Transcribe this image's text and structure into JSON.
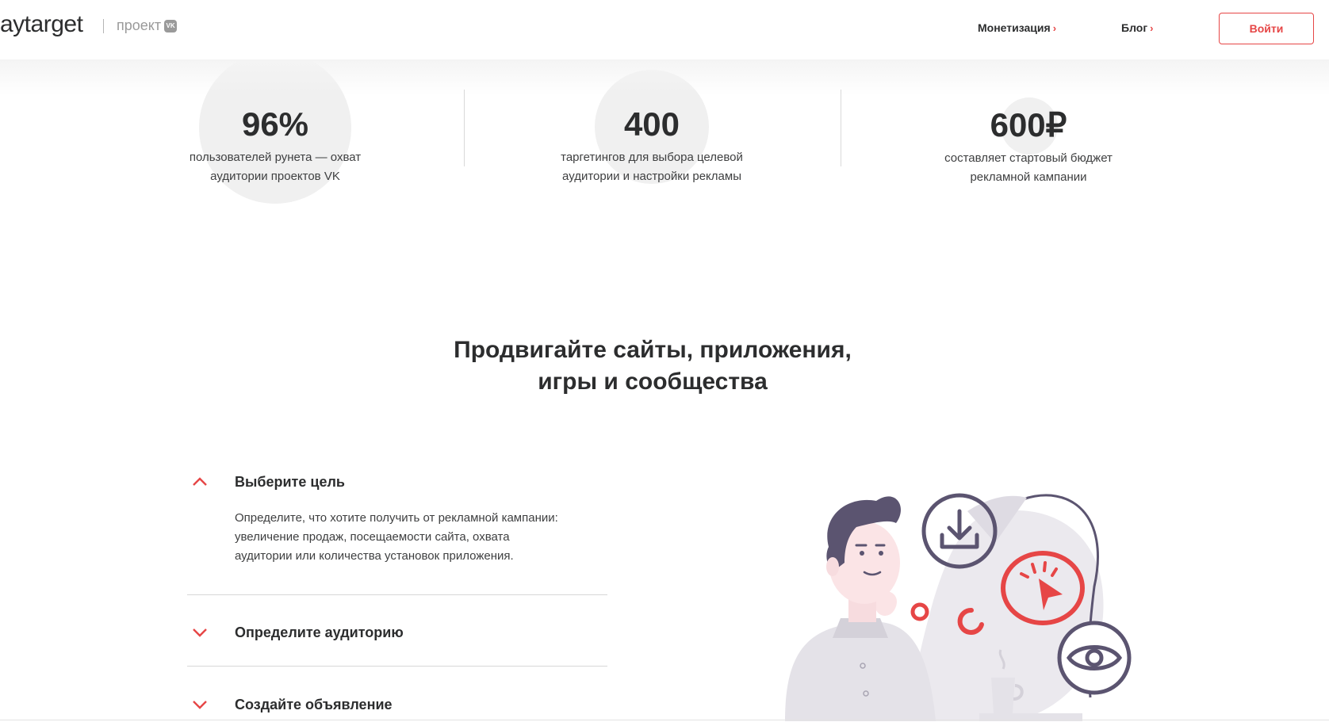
{
  "header": {
    "logo_text": "aytarget",
    "project_label": "проект",
    "vk_badge": "VK",
    "nav": [
      {
        "label": "Монетизация"
      },
      {
        "label": "Блог"
      }
    ],
    "login_label": "Войти"
  },
  "stats": [
    {
      "value": "96%",
      "desc_line1": "пользователей рунета — охват",
      "desc_line2": "аудитории проектов VK"
    },
    {
      "value": "400",
      "desc_line1": "таргетингов для выбора целевой",
      "desc_line2": "аудитории и настройки рекламы"
    },
    {
      "value": "600₽",
      "desc_line1": "составляет стартовый бюджет",
      "desc_line2": "рекламной кампании"
    }
  ],
  "headline": {
    "line1": "Продвигайте сайты, приложения,",
    "line2": "игры и сообщества"
  },
  "accordion": [
    {
      "title": "Выберите цель",
      "expanded": true,
      "text_line1": "Определите, что хотите получить от рекламной кампании:",
      "text_line2": "увеличение продаж, посещаемости сайта, охвата",
      "text_line3": "аудитории или количества установок приложения."
    },
    {
      "title": "Определите аудиторию",
      "expanded": false
    },
    {
      "title": "Создайте объявление",
      "expanded": false
    }
  ],
  "colors": {
    "accent": "#e64646",
    "text": "#2c2d2e",
    "illustration_purple": "#5b5470",
    "illustration_gray": "#e4e2e8"
  },
  "icons": [
    "chevron-right-icon",
    "chevron-up-icon",
    "chevron-down-icon",
    "download-icon",
    "click-cursor-icon",
    "eye-icon",
    "coffee-cup-icon"
  ]
}
